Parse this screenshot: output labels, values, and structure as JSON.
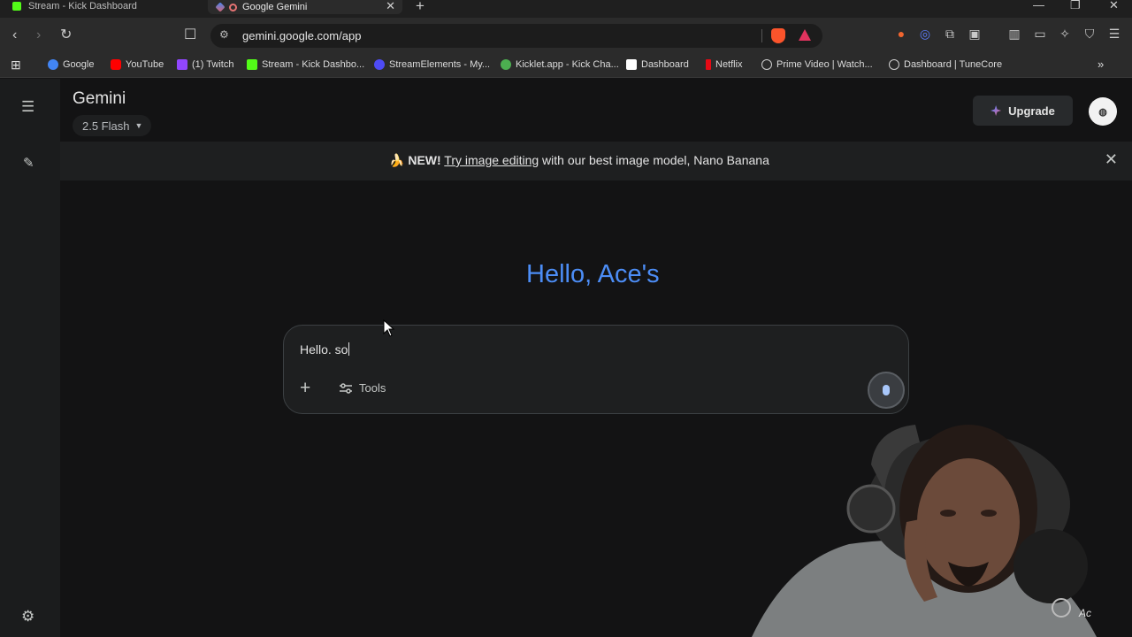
{
  "browser": {
    "tabs": [
      {
        "title": "Stream - Kick Dashboard",
        "active": false
      },
      {
        "title": "Google Gemini",
        "active": true
      }
    ],
    "new_tab": "+",
    "url": "gemini.google.com/app",
    "bookmarks": [
      {
        "label": "Google",
        "color": "#4285f4"
      },
      {
        "label": "YouTube",
        "color": "#ff0000"
      },
      {
        "label": "(1) Twitch",
        "color": "#9146ff"
      },
      {
        "label": "Stream - Kick Dashbo...",
        "color": "#53fc18"
      },
      {
        "label": "StreamElements - My...",
        "color": "#4e4bf5"
      },
      {
        "label": "Kicklet.app - Kick Cha...",
        "color": "#4caf50"
      },
      {
        "label": "Dashboard",
        "color": "#ffffff"
      },
      {
        "label": "Netflix",
        "color": "#e50914"
      },
      {
        "label": "Prime Video | Watch...",
        "color": "#cfcfcf"
      },
      {
        "label": "Dashboard | TuneCore",
        "color": "#cfcfcf"
      }
    ]
  },
  "app": {
    "brand": "Gemini",
    "model": "2.5 Flash",
    "upgrade_label": "Upgrade",
    "banner": {
      "emoji": "🍌",
      "prefix": "NEW!",
      "link": "Try image editing",
      "suffix": "with our best image model, Nano Banana"
    },
    "greeting": "Hello, Ace's",
    "prompt_value": "Hello. so",
    "tools_label": "Tools"
  },
  "colors": {
    "accent_blue": "#4c8df6",
    "background": "#131314",
    "surface": "#1e1f20"
  }
}
